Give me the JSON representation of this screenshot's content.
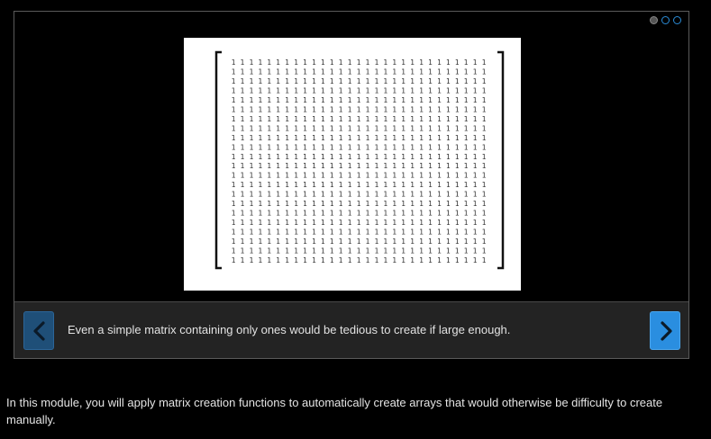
{
  "slideshow": {
    "dots": [
      {
        "state": "active"
      },
      {
        "state": "inactive"
      },
      {
        "state": "inactive"
      }
    ],
    "current_slide": 1,
    "total_slides": 3,
    "image": {
      "matrix_entry": "1",
      "columns": 29,
      "rows": 22
    },
    "caption": "Even a simple matrix containing only ones would be tedious to create if large enough.",
    "prev_icon": "chevron-left-icon",
    "next_icon": "chevron-right-icon"
  },
  "description": "In this module, you will apply matrix creation functions to automatically create arrays that would otherwise be difficulty to create manually.",
  "colors": {
    "background": "#000000",
    "caption_bar": "#232323",
    "accent_blue": "#2a8ee0",
    "prev_button": "#1f4f78"
  }
}
